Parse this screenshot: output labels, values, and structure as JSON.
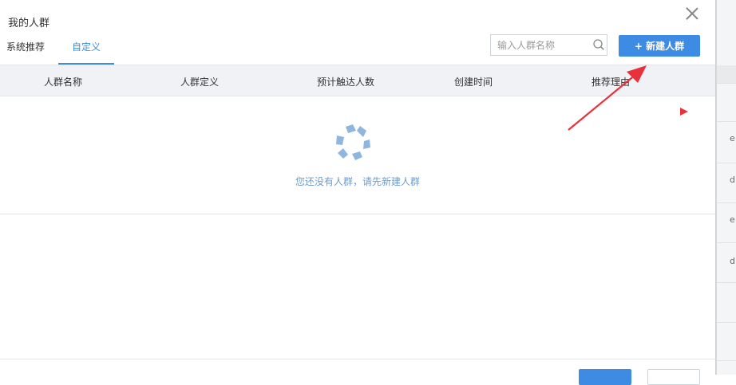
{
  "modal": {
    "title": "我的人群",
    "tabs": [
      {
        "label": "系统推荐",
        "active": false
      },
      {
        "label": "自定义",
        "active": true
      }
    ],
    "search": {
      "placeholder": "输入人群名称",
      "value": ""
    },
    "new_button_label": "+ 新建人群"
  },
  "table": {
    "columns": [
      "人群名称",
      "人群定义",
      "预计触达人数",
      "创建时间",
      "推荐理由"
    ],
    "empty_text": "您还没有人群，请先新建人群"
  },
  "background_page": {
    "glyphs": [
      "e",
      "d",
      "e",
      "d"
    ]
  },
  "colors": {
    "accent": "#3d8be3",
    "tab_active": "#3b8fd6",
    "empty_text": "#6d9ccc",
    "annotation_arrow": "#e8323b"
  },
  "icons": {
    "close": "close-icon",
    "search": "search-icon",
    "empty": "empty-star-icon",
    "annotation": "annotation-arrow"
  }
}
